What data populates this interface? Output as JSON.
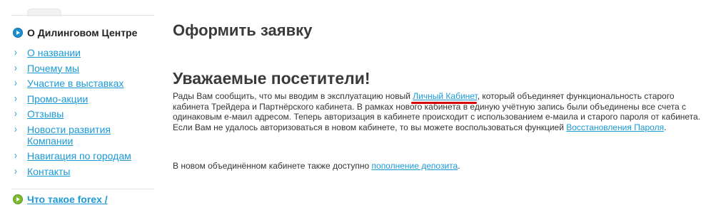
{
  "sidebar": {
    "title": "О Дилинговом Центре",
    "items": [
      {
        "label": "О названии"
      },
      {
        "label": "Почему мы"
      },
      {
        "label": "Участие в выставках"
      },
      {
        "label": "Промо-акции"
      },
      {
        "label": "Отзывы"
      },
      {
        "label": "Новости развития Компании"
      },
      {
        "label": "Навигация по городам"
      },
      {
        "label": "Контакты"
      }
    ],
    "next_section_title": "Что такое forex /"
  },
  "main": {
    "page_title": "Оформить заявку",
    "greeting": "Уважаемые посетители!",
    "paragraph1": {
      "part1": "Рады Вам сообщить, что мы вводим в эксплуатацию новый ",
      "link1": "Личный Кабинет",
      "part2": ", который объединяет функциональность старого кабинета Трейдера и Партнёрского кабинета. В рамках нового кабинета в единую учётную запись были объединены все счета с одинаковым е-маил адресом. Теперь авторизация в кабинете происходит с использованием е-маила и старого пароля от кабинета. Если Вам не удалось авторизоваться в новом кабинете, то вы можете воспользоваться функцией ",
      "link2": "Восстановления Пароля",
      "part3": "."
    },
    "paragraph2": {
      "part1": "В новом объединённом кабинете также доступно ",
      "link": "пополнение депозита",
      "part2": "."
    }
  },
  "colors": {
    "link": "#1a9ad6",
    "heading": "#3a3a3a",
    "highlight_underline": "#d40000"
  }
}
